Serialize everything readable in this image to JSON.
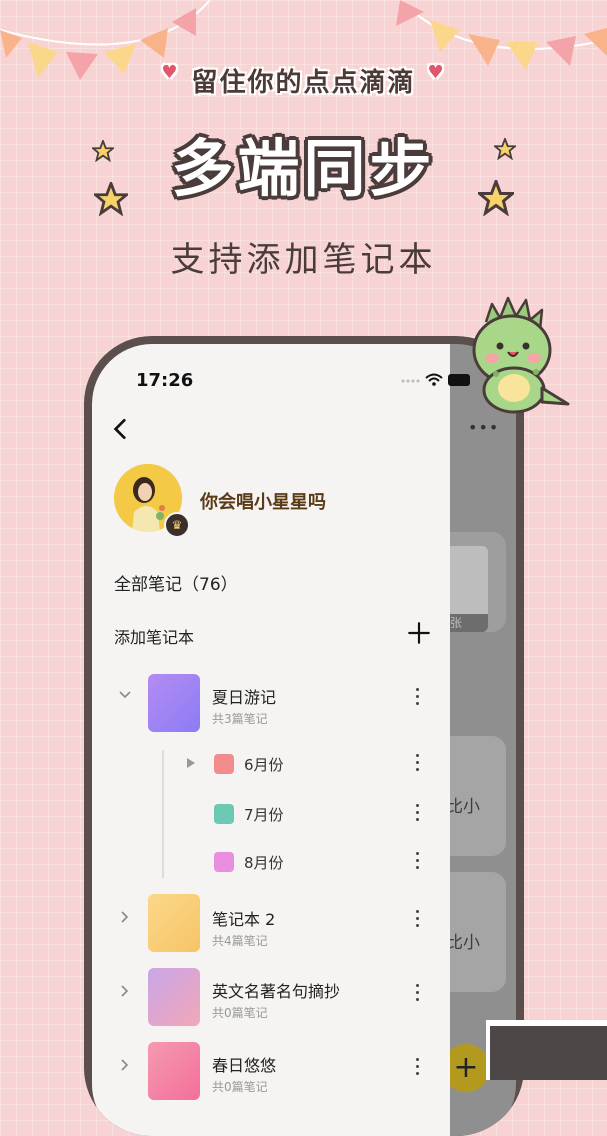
{
  "header": {
    "tagline": "留住你的点点滴滴",
    "headline": "多端同步",
    "subtitle": "支持添加笔记本"
  },
  "status_bar": {
    "time": "17:26"
  },
  "drawer": {
    "username": "你会唱小星星吗",
    "all_notes": "全部笔记（76）",
    "add_notebook": "添加笔记本",
    "notebooks": [
      {
        "title": "夏日游记",
        "count": "共3篇笔记",
        "expanded": true
      },
      {
        "title": "笔记本 2",
        "count": "共4篇笔记",
        "expanded": false
      },
      {
        "title": "英文名著名句摘抄",
        "count": "共0篇笔记",
        "expanded": false
      },
      {
        "title": "春日悠悠",
        "count": "共0篇笔记",
        "expanded": false
      }
    ],
    "sub_notebooks": [
      {
        "title": "6月份"
      },
      {
        "title": "7月份"
      },
      {
        "title": "8月份"
      }
    ]
  },
  "background_page": {
    "card_button": "张",
    "snippets": [
      "比小",
      "比小"
    ],
    "fab": "+"
  },
  "colors": {
    "background": "#f8d3d3",
    "headline_outline": "#4a3c3a",
    "accent_heart": "#e0566b",
    "username": "#5b3b17"
  }
}
